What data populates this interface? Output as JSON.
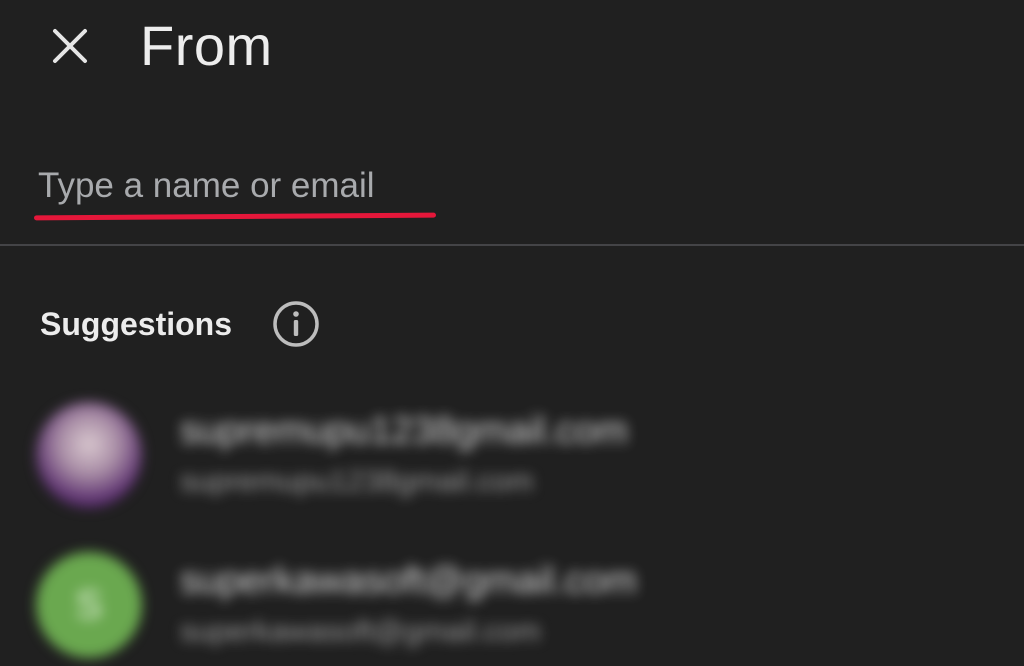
{
  "header": {
    "close_icon": "close-icon",
    "title": "From"
  },
  "recipient_field": {
    "value": "",
    "placeholder": "Type a name or email",
    "underline_color": "#e5173a"
  },
  "suggestions_section": {
    "heading": "Suggestions",
    "info_icon": "info-icon",
    "items": [
      {
        "name": "supremupu1238gmail.com",
        "email": "supremupu1238gmail.com",
        "avatar_type": "photo",
        "avatar_letter": ""
      },
      {
        "name": "superkawasoft@gmail.com",
        "email": "superkawasoft@gmail.com",
        "avatar_type": "letter",
        "avatar_letter": "S",
        "avatar_color": "#6aa84f"
      }
    ]
  },
  "colors": {
    "background": "#202020",
    "accent": "#e5173a",
    "divider": "#444447"
  }
}
